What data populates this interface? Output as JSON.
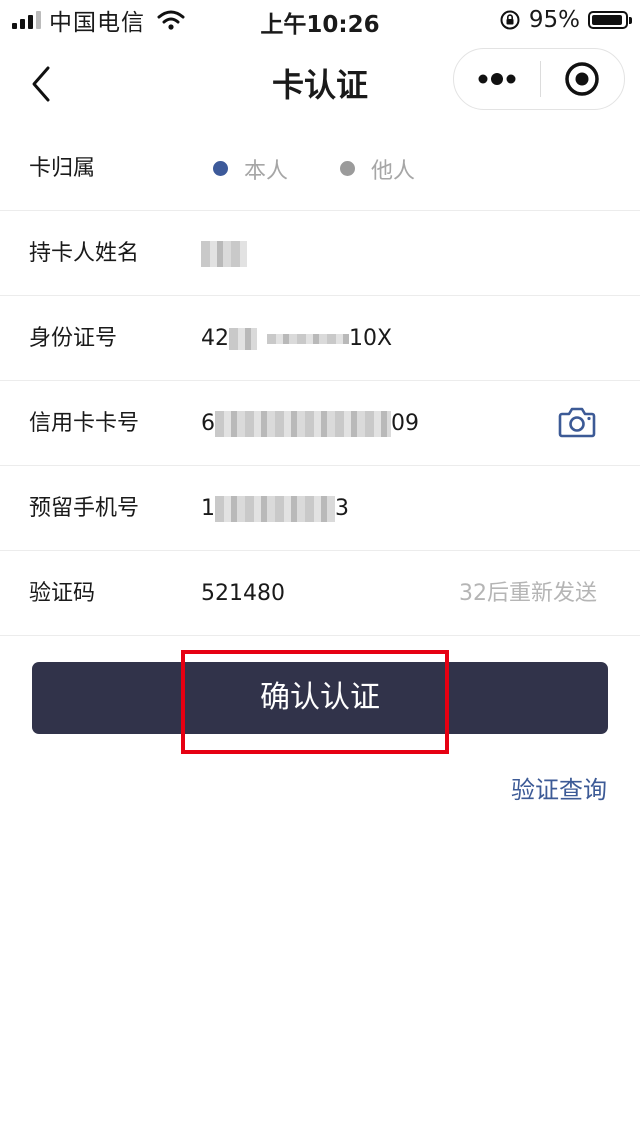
{
  "status_bar": {
    "carrier": "中国电信",
    "time": "上午10:26",
    "battery_percent": "95%",
    "battery_level": 0.95
  },
  "nav": {
    "title": "卡认证",
    "back_icon": "chevron-left-icon",
    "more_icon": "more-dots-icon",
    "close_icon": "target-circle-icon"
  },
  "form": {
    "card_owner": {
      "label": "卡归属",
      "options": [
        {
          "label": "本人",
          "color": "#3d5a9a",
          "selected": true
        },
        {
          "label": "他人",
          "color": "#9b9b9b",
          "selected": false
        }
      ]
    },
    "holder_name": {
      "label": "持卡人姓名"
    },
    "id_number": {
      "label": "身份证号",
      "prefix": "42",
      "suffix": "10X"
    },
    "card_number": {
      "label": "信用卡卡号",
      "prefix": "6",
      "suffix": "09",
      "camera_icon": "camera-icon"
    },
    "phone": {
      "label": "预留手机号",
      "prefix": "1",
      "suffix": "3"
    },
    "verify_code": {
      "label": "验证码",
      "value": "521480",
      "resend": "32后重新发送"
    }
  },
  "actions": {
    "confirm": "确认认证",
    "query": "验证查询"
  },
  "colors": {
    "accent": "#3c5a96",
    "button_bg": "#31334a",
    "highlight": "#e60012"
  }
}
